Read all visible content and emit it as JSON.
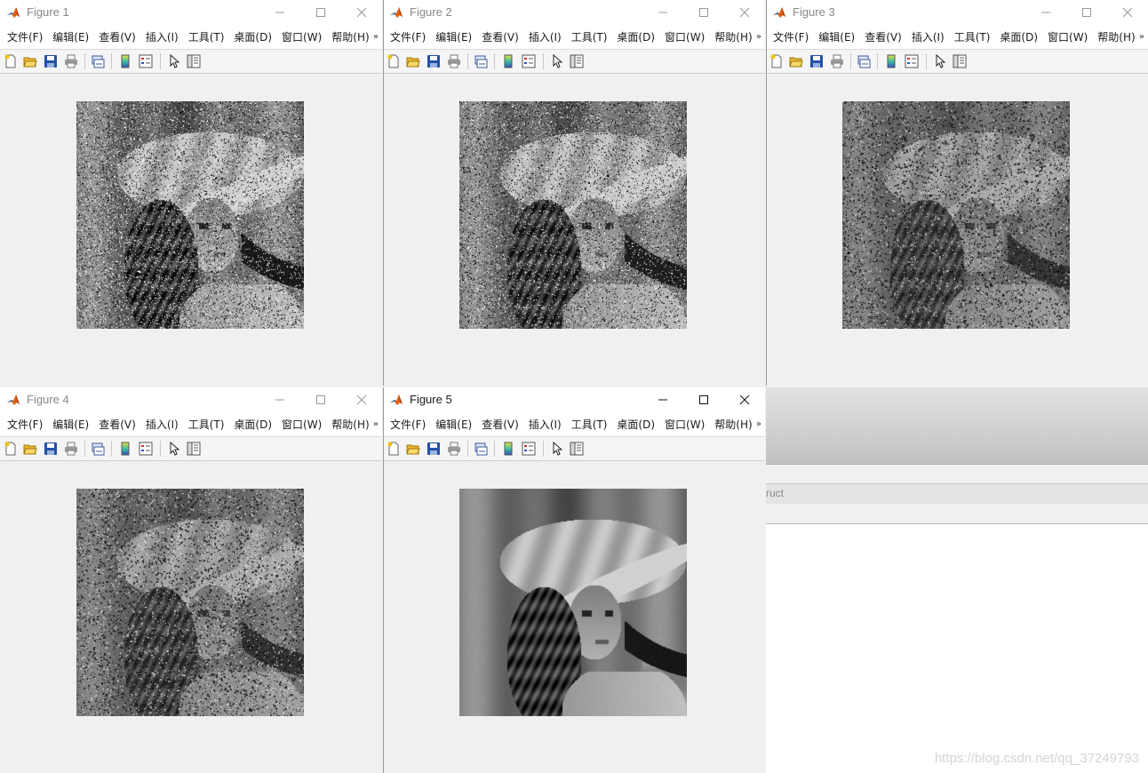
{
  "menu": [
    "文件(F)",
    "编辑(E)",
    "查看(V)",
    "插入(I)",
    "工具(T)",
    "桌面(D)",
    "窗口(W)",
    "帮助(H)"
  ],
  "menu_more": "»",
  "windows": [
    {
      "title": "Figure 1",
      "active": false,
      "image": {
        "kind": "noisy",
        "salt": 0.08,
        "pepper": 0.08,
        "contrast": 1.0,
        "speckle": 1,
        "seed": 11
      }
    },
    {
      "title": "Figure 2",
      "active": false,
      "image": {
        "kind": "noisy",
        "salt": 0.06,
        "pepper": 0.08,
        "contrast": 0.95,
        "speckle": 1,
        "seed": 23
      }
    },
    {
      "title": "Figure 3",
      "active": false,
      "image": {
        "kind": "filtered",
        "salt": 0.01,
        "pepper": 0.06,
        "contrast": 0.75,
        "speckle": 2,
        "seed": 37
      }
    },
    {
      "title": "Figure 4",
      "active": false,
      "image": {
        "kind": "filtered",
        "salt": 0.02,
        "pepper": 0.05,
        "contrast": 0.8,
        "speckle": 2,
        "seed": 53
      }
    },
    {
      "title": "Figure 5",
      "active": true,
      "image": {
        "kind": "clean",
        "salt": 0.0,
        "pepper": 0.0,
        "contrast": 1.05,
        "speckle": 0,
        "seed": 71
      }
    }
  ],
  "background_window": {
    "field_label": "ruct"
  },
  "watermark": "https://blog.csdn.net/qq_37249793"
}
